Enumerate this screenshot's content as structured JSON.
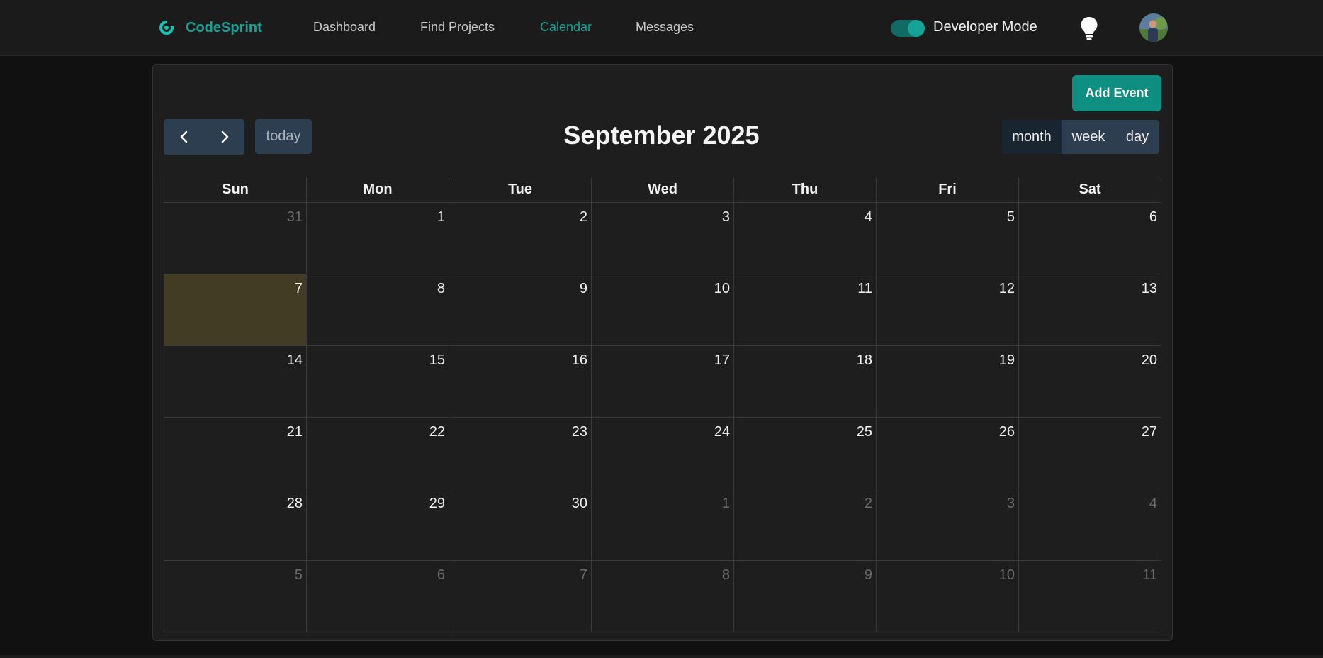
{
  "brand": {
    "name": "CodeSprint",
    "logo_icon": "brand-logo-icon",
    "accent": "#14a394"
  },
  "nav": {
    "links": [
      {
        "label": "Dashboard",
        "active": false
      },
      {
        "label": "Find Projects",
        "active": false
      },
      {
        "label": "Calendar",
        "active": true
      },
      {
        "label": "Messages",
        "active": false
      }
    ],
    "toggle_label": "Developer Mode",
    "toggle_on": true,
    "bulb_icon": "lightbulb-icon",
    "avatar_icon": "user-avatar"
  },
  "calendar": {
    "add_event_label": "Add Event",
    "prev_icon": "chevron-left-icon",
    "next_icon": "chevron-right-icon",
    "today_label": "today",
    "title": "September 2025",
    "views": [
      {
        "label": "month",
        "active": true
      },
      {
        "label": "week",
        "active": false
      },
      {
        "label": "day",
        "active": false
      }
    ],
    "weekdays": [
      "Sun",
      "Mon",
      "Tue",
      "Wed",
      "Thu",
      "Fri",
      "Sat"
    ],
    "weeks": [
      [
        {
          "d": "31",
          "o": true
        },
        {
          "d": "1"
        },
        {
          "d": "2"
        },
        {
          "d": "3"
        },
        {
          "d": "4"
        },
        {
          "d": "5"
        },
        {
          "d": "6"
        }
      ],
      [
        {
          "d": "7",
          "t": true
        },
        {
          "d": "8"
        },
        {
          "d": "9"
        },
        {
          "d": "10"
        },
        {
          "d": "11"
        },
        {
          "d": "12"
        },
        {
          "d": "13"
        }
      ],
      [
        {
          "d": "14"
        },
        {
          "d": "15"
        },
        {
          "d": "16"
        },
        {
          "d": "17"
        },
        {
          "d": "18"
        },
        {
          "d": "19"
        },
        {
          "d": "20"
        }
      ],
      [
        {
          "d": "21"
        },
        {
          "d": "22"
        },
        {
          "d": "23"
        },
        {
          "d": "24"
        },
        {
          "d": "25"
        },
        {
          "d": "26"
        },
        {
          "d": "27"
        }
      ],
      [
        {
          "d": "28"
        },
        {
          "d": "29"
        },
        {
          "d": "30"
        },
        {
          "d": "1",
          "o": true
        },
        {
          "d": "2",
          "o": true
        },
        {
          "d": "3",
          "o": true
        },
        {
          "d": "4",
          "o": true
        }
      ],
      [
        {
          "d": "5",
          "o": true
        },
        {
          "d": "6",
          "o": true
        },
        {
          "d": "7",
          "o": true
        },
        {
          "d": "8",
          "o": true
        },
        {
          "d": "9",
          "o": true
        },
        {
          "d": "10",
          "o": true
        },
        {
          "d": "11",
          "o": true
        }
      ]
    ],
    "today_color": "#433c25",
    "button_color": "#2c3e50"
  }
}
